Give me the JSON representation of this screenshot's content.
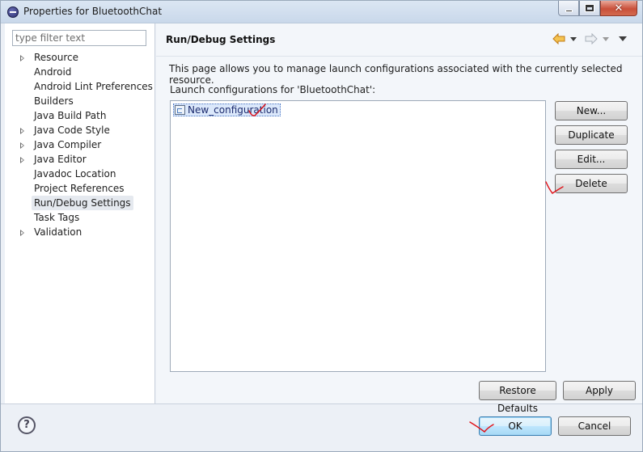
{
  "window": {
    "title": "Properties for BluetoothChat",
    "controls": {
      "minimize_icon": "minimize-icon",
      "maximize_icon": "maximize-icon",
      "close_icon": "close-icon",
      "close_glyph": "✕"
    }
  },
  "sidebar": {
    "filter_placeholder": "type filter text",
    "items": [
      {
        "label": "Resource",
        "expandable": true,
        "selected": false
      },
      {
        "label": "Android",
        "expandable": false,
        "selected": false
      },
      {
        "label": "Android Lint Preferences",
        "expandable": false,
        "selected": false
      },
      {
        "label": "Builders",
        "expandable": false,
        "selected": false
      },
      {
        "label": "Java Build Path",
        "expandable": false,
        "selected": false
      },
      {
        "label": "Java Code Style",
        "expandable": true,
        "selected": false
      },
      {
        "label": "Java Compiler",
        "expandable": true,
        "selected": false
      },
      {
        "label": "Java Editor",
        "expandable": true,
        "selected": false
      },
      {
        "label": "Javadoc Location",
        "expandable": false,
        "selected": false
      },
      {
        "label": "Project References",
        "expandable": false,
        "selected": false
      },
      {
        "label": "Run/Debug Settings",
        "expandable": false,
        "selected": true
      },
      {
        "label": "Task Tags",
        "expandable": false,
        "selected": false
      },
      {
        "label": "Validation",
        "expandable": true,
        "selected": false
      }
    ]
  },
  "main": {
    "title": "Run/Debug Settings",
    "description": "This page allows you to manage launch configurations associated with the currently selected resource.",
    "list_label": "Launch configurations for 'BluetoothChat':",
    "configurations": [
      {
        "label": "New_configuration",
        "selected": true
      }
    ],
    "buttons": {
      "new": "New...",
      "duplicate": "Duplicate",
      "edit": "Edit...",
      "delete": "Delete"
    },
    "restore_defaults": "Restore Defaults",
    "apply": "Apply",
    "nav": {
      "back_icon": "back-arrow-icon",
      "forward_icon": "forward-arrow-icon",
      "menu_icon": "view-menu-icon"
    }
  },
  "footer": {
    "help_glyph": "?",
    "ok": "OK",
    "cancel": "Cancel"
  },
  "colors": {
    "annotation_red": "#e0151b",
    "nav_arrow_orange": "#e8a23a",
    "selection_blue": "#dbe8fb"
  }
}
